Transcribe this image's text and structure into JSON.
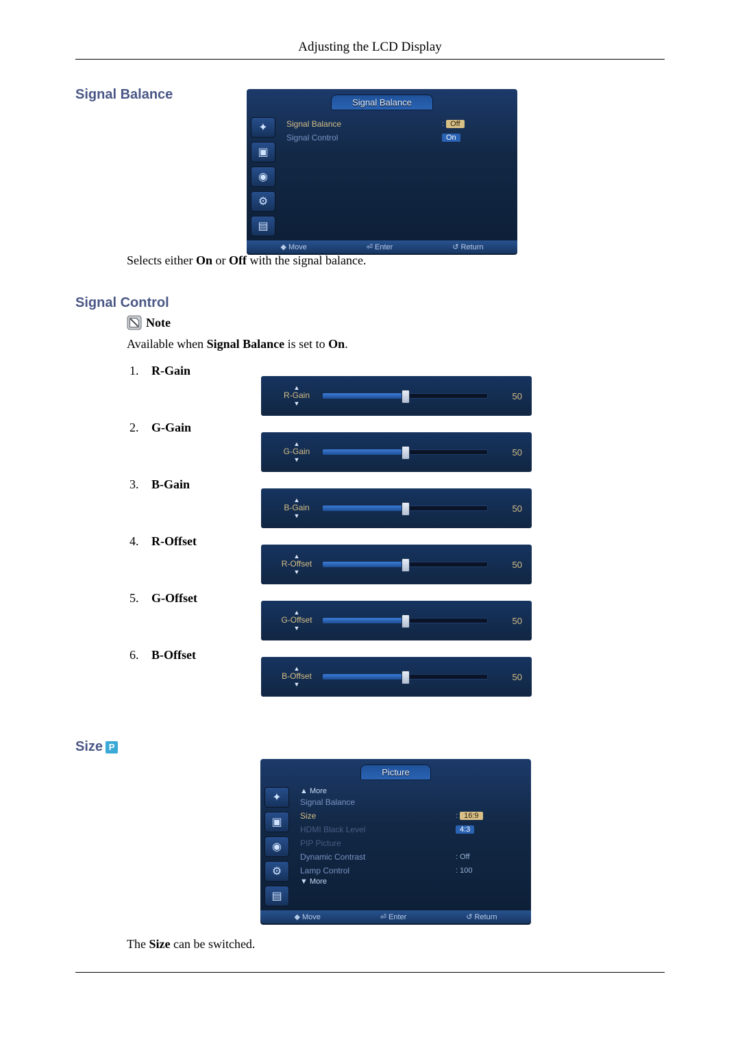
{
  "page": {
    "header": "Adjusting the LCD Display"
  },
  "section1": {
    "title": "Signal Balance",
    "desc_pre": "Selects either ",
    "on": "On",
    "or_txt": " or ",
    "off": "Off",
    "desc_post": " with the signal balance."
  },
  "osd_balance": {
    "title": "Signal Balance",
    "row1": "Signal Balance",
    "row2": "Signal Control",
    "opt_off": "Off",
    "opt_on": "On",
    "foot_move": "◆ Move",
    "foot_enter": "⏎ Enter",
    "foot_return": "↺ Return"
  },
  "icons": {
    "i1": "✦",
    "i2": "▣",
    "i3": "◉",
    "i4": "⚙",
    "i5": "▤"
  },
  "section2": {
    "title": "Signal Control",
    "note": "Note",
    "avail_pre": "Available when ",
    "avail_sb": "Signal Balance",
    "avail_mid": " is set to ",
    "avail_on": "On",
    "avail_post": "."
  },
  "sliders": [
    {
      "name": "R-Gain",
      "value": "50"
    },
    {
      "name": "G-Gain",
      "value": "50"
    },
    {
      "name": "B-Gain",
      "value": "50"
    },
    {
      "name": "R-Offset",
      "value": "50"
    },
    {
      "name": "G-Offset",
      "value": "50"
    },
    {
      "name": "B-Offset",
      "value": "50"
    }
  ],
  "section3": {
    "title": "Size",
    "badge": "P",
    "desc_pre": "The ",
    "size_b": "Size",
    "desc_post": " can be switched."
  },
  "osd_picture": {
    "title": "Picture",
    "more_up": "▲ More",
    "r_sig_bal": "Signal Balance",
    "r_size": "Size",
    "r_hdmi": "HDMI Black Level",
    "r_pip": "PIP Picture",
    "r_dyn": "Dynamic Contrast",
    "r_lamp": "Lamp Control",
    "more_dn": "▼ More",
    "v_size1": "16:9",
    "v_size2": "4:3",
    "v_dyn": ": Off",
    "v_lamp": ": 100",
    "foot_move": "◆ Move",
    "foot_enter": "⏎ Enter",
    "foot_return": "↺ Return"
  }
}
